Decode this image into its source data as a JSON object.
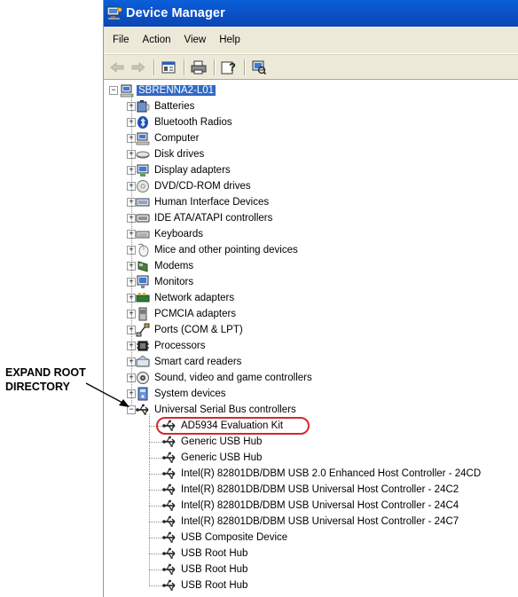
{
  "window": {
    "title": "Device Manager",
    "title_icon": "device-manager-icon",
    "titlebar_color": "#0b55d0"
  },
  "menu": [
    {
      "label": "File",
      "name": "menu-file"
    },
    {
      "label": "Action",
      "name": "menu-action"
    },
    {
      "label": "View",
      "name": "menu-view"
    },
    {
      "label": "Help",
      "name": "menu-help"
    }
  ],
  "toolbar": [
    {
      "icon": "back-arrow-icon"
    },
    {
      "icon": "forward-arrow-icon"
    },
    {
      "icon": "properties-icon"
    },
    {
      "icon": "print-icon"
    },
    {
      "icon": "help-icon"
    },
    {
      "icon": "scan-hardware-icon"
    }
  ],
  "tree": {
    "root": {
      "label": "SBRENNA2-L01",
      "icon": "computer-icon",
      "expanded": true,
      "selected": true
    },
    "categories": [
      {
        "label": "Batteries",
        "icon": "battery-icon"
      },
      {
        "label": "Bluetooth Radios",
        "icon": "bluetooth-icon"
      },
      {
        "label": "Computer",
        "icon": "computer-icon"
      },
      {
        "label": "Disk drives",
        "icon": "disk-drive-icon"
      },
      {
        "label": "Display adapters",
        "icon": "display-adapter-icon"
      },
      {
        "label": "DVD/CD-ROM drives",
        "icon": "cdrom-icon"
      },
      {
        "label": "Human Interface Devices",
        "icon": "hid-icon"
      },
      {
        "label": "IDE ATA/ATAPI controllers",
        "icon": "ide-controller-icon"
      },
      {
        "label": "Keyboards",
        "icon": "keyboard-icon"
      },
      {
        "label": "Mice and other pointing devices",
        "icon": "mouse-icon"
      },
      {
        "label": "Modems",
        "icon": "modem-icon"
      },
      {
        "label": "Monitors",
        "icon": "monitor-icon"
      },
      {
        "label": "Network adapters",
        "icon": "network-adapter-icon"
      },
      {
        "label": "PCMCIA adapters",
        "icon": "pcmcia-icon"
      },
      {
        "label": "Ports (COM & LPT)",
        "icon": "port-icon"
      },
      {
        "label": "Processors",
        "icon": "processor-icon"
      },
      {
        "label": "Smart card readers",
        "icon": "smart-card-icon"
      },
      {
        "label": "Sound, video and game controllers",
        "icon": "sound-icon"
      },
      {
        "label": "System devices",
        "icon": "system-devices-icon"
      },
      {
        "label": "Universal Serial Bus controllers",
        "icon": "usb-icon",
        "expanded": true
      }
    ],
    "usb_children": [
      {
        "label": "AD5934 Evaluation Kit",
        "icon": "usb-icon",
        "highlighted": true
      },
      {
        "label": "Generic USB Hub",
        "icon": "usb-icon"
      },
      {
        "label": "Generic USB Hub",
        "icon": "usb-icon"
      },
      {
        "label": "Intel(R) 82801DB/DBM USB 2.0 Enhanced Host Controller - 24CD",
        "icon": "usb-icon"
      },
      {
        "label": "Intel(R) 82801DB/DBM USB Universal Host Controller - 24C2",
        "icon": "usb-icon"
      },
      {
        "label": "Intel(R) 82801DB/DBM USB Universal Host Controller - 24C4",
        "icon": "usb-icon"
      },
      {
        "label": "Intel(R) 82801DB/DBM USB Universal Host Controller - 24C7",
        "icon": "usb-icon"
      },
      {
        "label": "USB Composite Device",
        "icon": "usb-icon"
      },
      {
        "label": "USB Root Hub",
        "icon": "usb-icon"
      },
      {
        "label": "USB Root Hub",
        "icon": "usb-icon"
      },
      {
        "label": "USB Root Hub",
        "icon": "usb-icon"
      }
    ]
  },
  "annotation": {
    "line1": "EXPAND ROOT",
    "line2": "DIRECTORY",
    "highlight_color": "#d7272f"
  }
}
